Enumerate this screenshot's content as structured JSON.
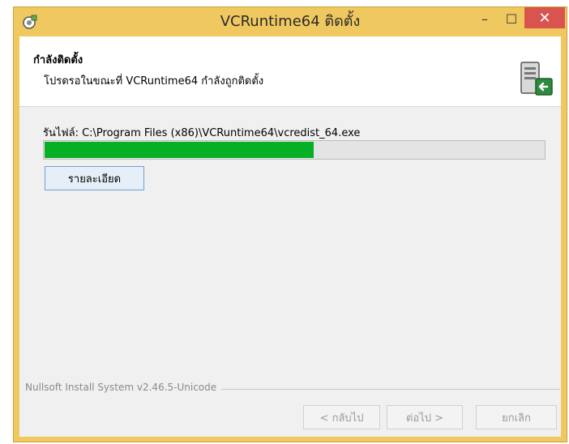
{
  "window": {
    "title": "VCRuntime64 ติดตั้ง",
    "minimize_glyph": "–",
    "maximize_glyph": "☐",
    "close_glyph": "✕"
  },
  "header": {
    "title": "กำลังติดตั้ง",
    "subtitle": "โปรดรอในขณะที่ VCRuntime64 กำลังถูกติดตั้ง",
    "icon": "installer-computer-icon"
  },
  "progress": {
    "file_label": "รันไฟล์: C:\\Program Files (x86)\\VCRuntime64\\vcredist_64.exe",
    "percent": 54,
    "fill_color": "#06b025"
  },
  "details_button": {
    "label": "รายละเอียด"
  },
  "branding": {
    "text": "Nullsoft Install System v2.46.5-Unicode"
  },
  "buttons": {
    "back": "< กลับไป",
    "next": "ต่อไป >",
    "cancel": "ยกเลิก"
  },
  "colors": {
    "titlebar": "#f0c860",
    "close_button": "#d9534f",
    "client_bg": "#f0f0f0"
  }
}
